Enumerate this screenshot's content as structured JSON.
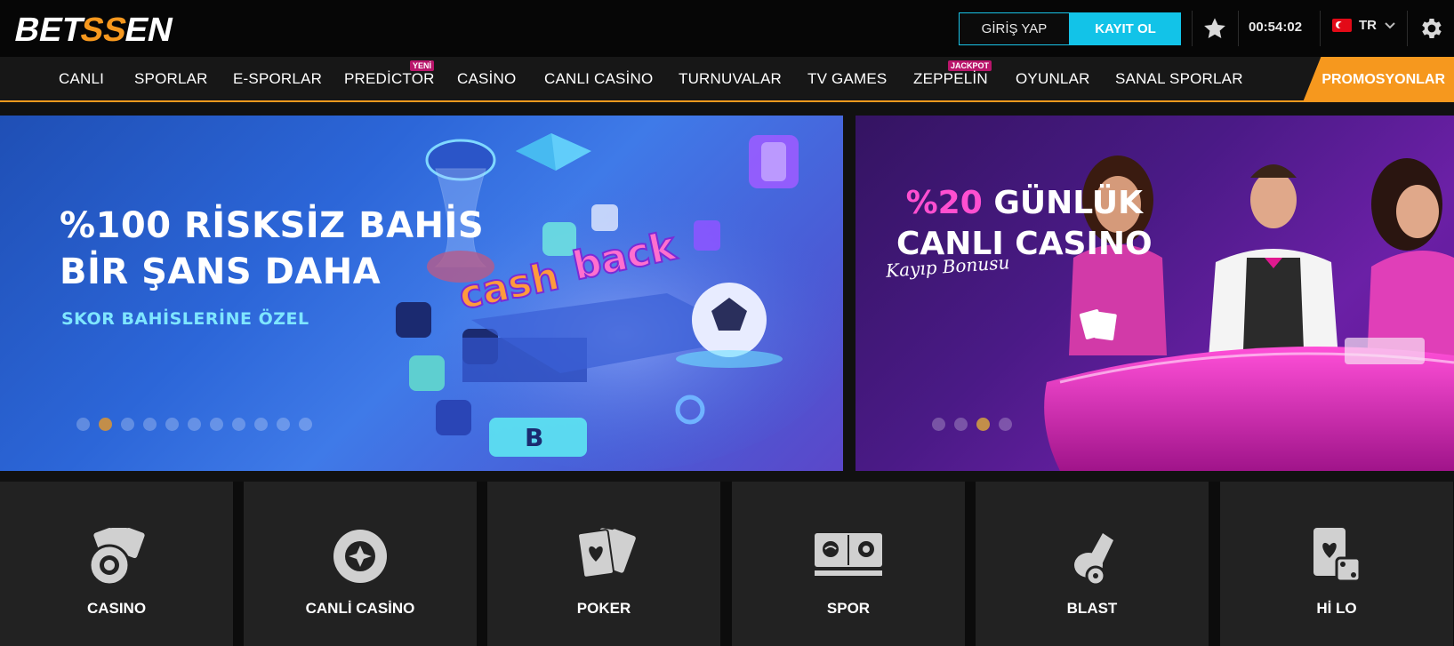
{
  "brand": {
    "logo_text_1": "BET",
    "logo_text_2": "SS",
    "logo_text_3": "EN"
  },
  "header": {
    "login_label": "GİRİŞ YAP",
    "register_label": "KAYIT OL",
    "clock": "00:54:02",
    "language": "TR",
    "icons": [
      "star-icon",
      "turkey-flag-icon",
      "chevron-down-icon",
      "gear-icon"
    ]
  },
  "nav": {
    "items": [
      {
        "label": "CANLI"
      },
      {
        "label": "SPORLAR"
      },
      {
        "label": "E-SPORLAR"
      },
      {
        "label": "PREDİCTOR",
        "badge": "YENİ"
      },
      {
        "label": "CASİNO"
      },
      {
        "label": "CANLI CASİNO"
      },
      {
        "label": "TURNUVALAR"
      },
      {
        "label": "TV GAMES"
      },
      {
        "label": "ZEPPELİN",
        "badge": "JACKPOT"
      },
      {
        "label": "OYUNLAR"
      },
      {
        "label": "SANAL SPORLAR"
      }
    ],
    "promo_label": "PROMOSYONLAR"
  },
  "banners": [
    {
      "title_line1": "%100 RİSKSİZ BAHİS",
      "title_line2": "BİR ŞANS DAHA",
      "subtitle": "SKOR BAHİSLERİNE ÖZEL",
      "art_text_1": "cash",
      "art_text_2": "back",
      "dots": 11,
      "active_dot": 2
    },
    {
      "title_highlight": "%20",
      "title_line1_rest": " GÜNLÜK",
      "title_line2": "CANLI CASINO",
      "script_text": "Kayıp Bonusu",
      "dots": 4,
      "active_dot": 3
    }
  ],
  "tiles": [
    {
      "label": "CASINO",
      "icon": "casino-chips-cards-icon"
    },
    {
      "label": "CANLİ CASİNO",
      "icon": "live-casino-chip-icon"
    },
    {
      "label": "POKER",
      "icon": "poker-cards-icon"
    },
    {
      "label": "SPOR",
      "icon": "sports-balls-icon"
    },
    {
      "label": "BLAST",
      "icon": "cannon-icon"
    },
    {
      "label": "Hİ LO",
      "icon": "card-dice-icon"
    }
  ],
  "colors": {
    "accent_orange": "#f6981e",
    "accent_cyan": "#12c3e8",
    "badge_magenta": "#b9156b"
  }
}
